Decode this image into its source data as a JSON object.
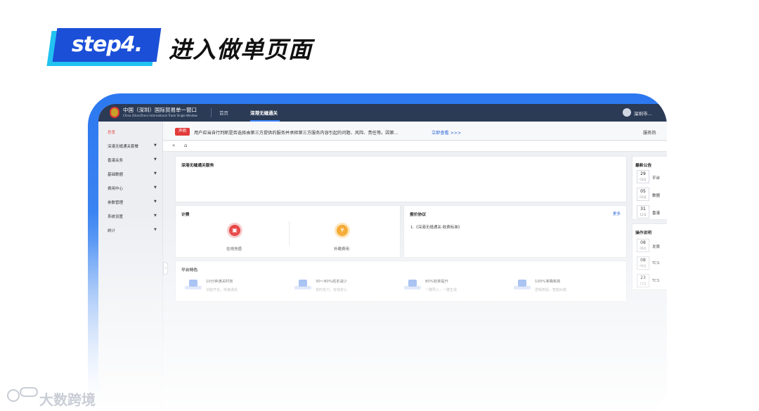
{
  "step": {
    "label": "step4.",
    "heading": "进入做单页面"
  },
  "topbar": {
    "portal_title": "中国（深圳）国际贸易单一窗口",
    "portal_subtitle": "China (ShenZhen) International Trade Single Window",
    "nav": [
      "首页",
      "深港无缝通关"
    ],
    "user": "深圳市..."
  },
  "sidebar": {
    "items": [
      {
        "label": "总览",
        "has_arrow": false
      },
      {
        "label": "深港无缝通关套餐",
        "has_arrow": true
      },
      {
        "label": "香港关务",
        "has_arrow": true
      },
      {
        "label": "基础数据",
        "has_arrow": true
      },
      {
        "label": "费用中心",
        "has_arrow": true
      },
      {
        "label": "参数管理",
        "has_arrow": true
      },
      {
        "label": "系统设置",
        "has_arrow": true
      },
      {
        "label": "统计",
        "has_arrow": true
      }
    ]
  },
  "notice": {
    "tag": "声明",
    "text": "用户应当自行判断是否选择由第三方提供的服务并承担第三方服务内容引起的问题、风险、责任等。因第...",
    "link": "立即查看 >>>",
    "right": "服务热"
  },
  "main": {
    "service_title": "深港无缝通关服务",
    "billing": {
      "title": "计费",
      "items": [
        {
          "label": "在线充值",
          "icon": "inbox-icon"
        },
        {
          "label": "补缴费用",
          "icon": "money-bag-icon"
        }
      ]
    },
    "protocol": {
      "title": "报价协议",
      "more": "更多",
      "items": [
        "1.《深港无缝通关-收费标准》"
      ]
    },
    "features": {
      "title": "平台特色",
      "items": [
        {
          "title": "10分钟通关时效",
          "desc": "功能齐全，快速通关"
        },
        {
          "title": "30～80%成本减少",
          "desc": "省时省力，省钱省心"
        },
        {
          "title": "80%效率提升",
          "desc": "一键导入，一键生成"
        },
        {
          "title": "100%准确率高",
          "desc": "逻辑校验，智能纠错"
        }
      ]
    }
  },
  "right_panel": {
    "news_title": "最新公告",
    "news": [
      {
        "day": "29",
        "month": "03月",
        "text": "平台"
      },
      {
        "day": "05",
        "month": "03月",
        "text": "数据"
      },
      {
        "day": "31",
        "month": "12月",
        "text": "香港"
      }
    ],
    "guide_title": "操作说明",
    "guides": [
      {
        "day": "08",
        "month": "09月",
        "text": "发票"
      },
      {
        "day": "08",
        "month": "09月",
        "text": "TCS"
      },
      {
        "day": "23",
        "month": "12月",
        "text": "TCS"
      }
    ]
  },
  "watermark": "大数跨境",
  "colors": {
    "accent_blue": "#1b4fd8",
    "frame_blue": "#2c78f0",
    "topbar": "#2b3a55",
    "alert_red": "#e23b3b"
  }
}
